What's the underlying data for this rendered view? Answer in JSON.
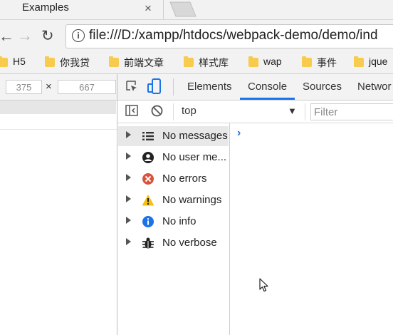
{
  "browser": {
    "tab_title": "Examples",
    "tab_close": "×",
    "url": "file:///D:/xampp/htdocs/webpack-demo/demo/ind",
    "bookmarks": [
      {
        "label": "H5"
      },
      {
        "label": "你我贷"
      },
      {
        "label": "前端文章"
      },
      {
        "label": "样式库"
      },
      {
        "label": "wap"
      },
      {
        "label": "事件"
      },
      {
        "label": "jque"
      }
    ]
  },
  "device": {
    "width": "375",
    "times": "×",
    "height": "667"
  },
  "devtools": {
    "tabs": [
      "Elements",
      "Console",
      "Sources",
      "Networ"
    ],
    "active_tab": "Console",
    "context": "top",
    "filter_placeholder": "Filter",
    "sidebar": [
      {
        "label": "No messages",
        "icon": "list-icon"
      },
      {
        "label": "No user me...",
        "icon": "user-icon"
      },
      {
        "label": "No errors",
        "icon": "error-icon"
      },
      {
        "label": "No warnings",
        "icon": "warning-icon"
      },
      {
        "label": "No info",
        "icon": "info-icon"
      },
      {
        "label": "No verbose",
        "icon": "bug-icon"
      }
    ],
    "prompt": "›"
  },
  "colors": {
    "accent": "#1a73e8",
    "error": "#d9533c",
    "warning": "#f4c013",
    "info": "#1a73e8",
    "folder": "#f7cb4d"
  }
}
